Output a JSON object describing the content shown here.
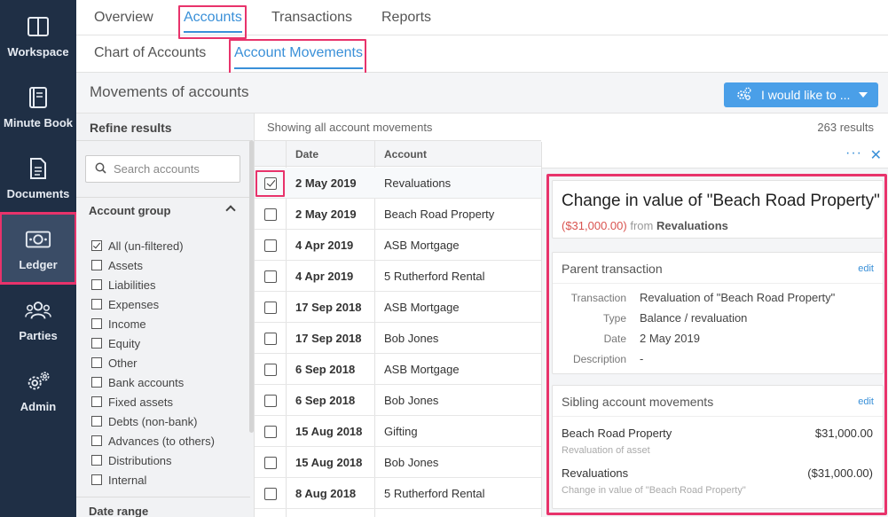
{
  "nav": {
    "items": [
      {
        "label": "Workspace",
        "icon": "workspace-icon"
      },
      {
        "label": "Minute Book",
        "icon": "book-icon"
      },
      {
        "label": "Documents",
        "icon": "document-icon"
      },
      {
        "label": "Ledger",
        "icon": "money-icon",
        "active": true
      },
      {
        "label": "Parties",
        "icon": "people-icon"
      },
      {
        "label": "Admin",
        "icon": "gear-icon"
      }
    ]
  },
  "tabs": [
    "Overview",
    "Accounts",
    "Transactions",
    "Reports"
  ],
  "active_tab": "Accounts",
  "subtabs": [
    "Chart of Accounts",
    "Account Movements"
  ],
  "active_subtab": "Account Movements",
  "page": {
    "title": "Movements of accounts",
    "action_button": "I would like to ..."
  },
  "refine": {
    "title": "Refine results",
    "search_placeholder": "Search accounts",
    "group_title": "Account group",
    "filters": [
      {
        "label": "All (un-filtered)",
        "checked": true
      },
      {
        "label": "Assets",
        "checked": false
      },
      {
        "label": "Liabilities",
        "checked": false
      },
      {
        "label": "Expenses",
        "checked": false
      },
      {
        "label": "Income",
        "checked": false
      },
      {
        "label": "Equity",
        "checked": false
      },
      {
        "label": "Other",
        "checked": false
      },
      {
        "label": "Bank accounts",
        "checked": false
      },
      {
        "label": "Fixed assets",
        "checked": false
      },
      {
        "label": "Debts (non-bank)",
        "checked": false
      },
      {
        "label": "Advances (to others)",
        "checked": false
      },
      {
        "label": "Distributions",
        "checked": false
      },
      {
        "label": "Internal",
        "checked": false
      }
    ],
    "date_range": "Date range"
  },
  "table": {
    "showing": "Showing all account movements",
    "results": "263 results",
    "headers": {
      "date": "Date",
      "account": "Account"
    },
    "rows": [
      {
        "date": "2 May 2019",
        "account": "Revaluations",
        "checked": true
      },
      {
        "date": "2 May 2019",
        "account": "Beach Road Property",
        "checked": false
      },
      {
        "date": "4 Apr 2019",
        "account": "ASB Mortgage",
        "checked": false
      },
      {
        "date": "4 Apr 2019",
        "account": "5 Rutherford Rental",
        "checked": false
      },
      {
        "date": "17 Sep 2018",
        "account": "ASB Mortgage",
        "checked": false
      },
      {
        "date": "17 Sep 2018",
        "account": "Bob Jones",
        "checked": false
      },
      {
        "date": "6 Sep 2018",
        "account": "ASB Mortgage",
        "checked": false
      },
      {
        "date": "6 Sep 2018",
        "account": "Bob Jones",
        "checked": false
      },
      {
        "date": "15 Aug 2018",
        "account": "Gifting",
        "checked": false
      },
      {
        "date": "15 Aug 2018",
        "account": "Bob Jones",
        "checked": false
      },
      {
        "date": "8 Aug 2018",
        "account": "5 Rutherford Rental",
        "checked": false
      }
    ]
  },
  "detail": {
    "more_label": "···",
    "close_label": "✕",
    "title": "Change in value of \"Beach Road Property\"",
    "amount": "($31,000.00)",
    "from_text": "from",
    "from_account": "Revaluations",
    "parent": {
      "title": "Parent transaction",
      "edit": "edit",
      "fields": [
        {
          "key": "Transaction",
          "value": "Revaluation of \"Beach Road Property\""
        },
        {
          "key": "Type",
          "value": "Balance / revaluation"
        },
        {
          "key": "Date",
          "value": "2 May 2019"
        },
        {
          "key": "Description",
          "value": "-"
        }
      ]
    },
    "siblings": {
      "title": "Sibling account movements",
      "edit": "edit",
      "items": [
        {
          "name": "Beach Road Property",
          "amount": "$31,000.00",
          "sub": "Revaluation of asset",
          "negative": false
        },
        {
          "name": "Revaluations",
          "amount": "($31,000.00)",
          "sub": "Change in value of \"Beach Road Property\"",
          "negative": true
        }
      ]
    }
  },
  "colors": {
    "nav_bg": "#1f2f45",
    "accent": "#3a90d8",
    "highlight": "#e8336b",
    "negative": "#d9534f",
    "button": "#4a9fe8"
  }
}
